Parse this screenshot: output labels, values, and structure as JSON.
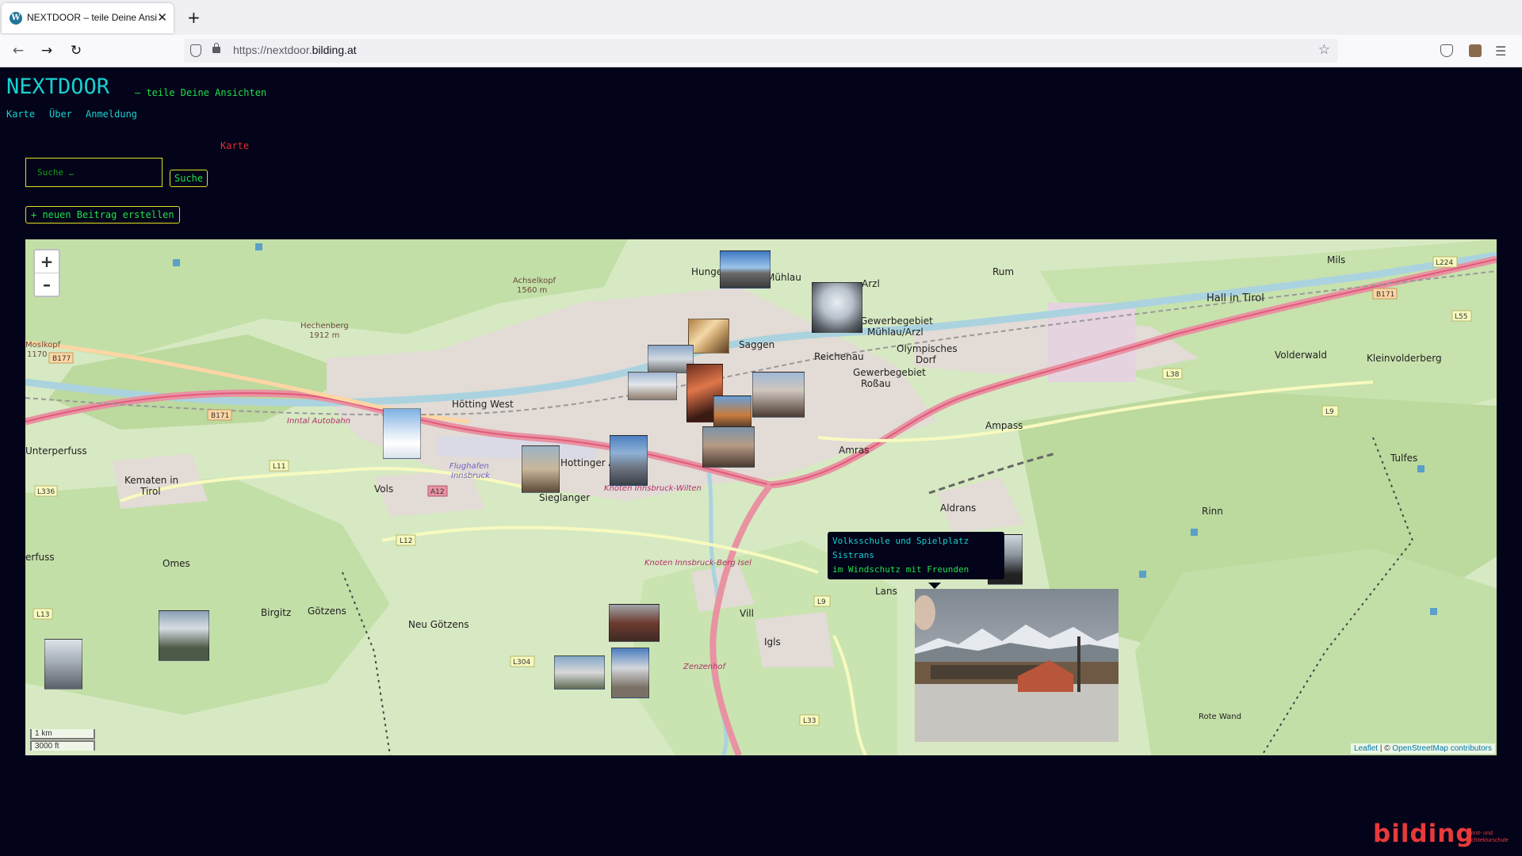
{
  "browser": {
    "tab_title": "NEXTDOOR – teile Deine Ansichten",
    "url_prefix": "https://nextdoor.",
    "url_domain": "bilding.at"
  },
  "site": {
    "title": "NEXTDOOR",
    "tagline": "– teile Deine Ansichten",
    "nav": [
      "Karte",
      "Über",
      "Anmeldung"
    ],
    "page_heading": "Karte",
    "search_placeholder": "Suche …",
    "search_button": "Suche",
    "new_post_button": "+ neuen Beitrag erstellen"
  },
  "map": {
    "zoom_in": "+",
    "zoom_out": "–",
    "scale_metric": "1 km",
    "scale_imperial": "3000 ft",
    "attribution_leaflet": "Leaflet",
    "attribution_sep": " | © ",
    "attribution_osm": "OpenStreetMap contributors",
    "labels": {
      "hungerburg": "Hunge",
      "muhlau": "Mühlau",
      "arzl": "Arzl",
      "rum": "Rum",
      "mils": "Mils",
      "hall": "Hall in Tirol",
      "saggen": "Saggen",
      "gewerbe_muhlau": "Gewerbegebiet\nMühlau/Arzl",
      "olympisches": "Olympisches\nDorf",
      "reichenau": "Reichenau",
      "gewerbe_rossau": "Gewerbegebiet\nRoßau",
      "volderwald": "Volderwald",
      "kleinvolderberg": "Kleinvolderberg",
      "hotting_west": "Hötting West",
      "innsbruck": "Innsbruck",
      "unterperfuss": "Unterperfuss",
      "kematen": "Kematen in\nTirol",
      "vols": "Vols",
      "hottinger": "Hottinger A",
      "sieglanger": "Sieglanger",
      "amras": "Amras",
      "ampass": "Ampass",
      "aldrans": "Aldrans",
      "rinn": "Rinn",
      "tulfes": "Tulfes",
      "omes": "Omes",
      "birgitz": "Birgitz",
      "gotzens": "Götzens",
      "neu_gotzens": "Neu Götzens",
      "vill": "Vill",
      "igls": "Igls",
      "lans": "Lans",
      "rote_wand": "Rote Wand",
      "perfuss": "erfuss",
      "achselkopf": "Achselkopf\n1560 m",
      "hechenberg": "Hechenberg\n1912 m",
      "moslkopf": "Moslkopf\n1170 m",
      "flughafen": "Flughafen\nInnsbruck",
      "inntal": "Inntal Autobahn",
      "b171": "B171",
      "b177": "B177",
      "l11": "L11",
      "l12": "L12",
      "l13": "L13",
      "l336": "L336",
      "a12": "A12",
      "l304": "L304",
      "l33": "L33",
      "l38": "L38",
      "l9": "L9",
      "l224": "L224",
      "l55": "L55",
      "zenzenhof": "Zenzenhof",
      "knoten_berg_isel": "Knoten Innsbruck-Berg Isel",
      "knoten_wilten": "Knoten Innsbruck-Wilten"
    }
  },
  "popup": {
    "title_line1": "Volksschule und Spielplatz",
    "title_line2": "Sistrans",
    "subtitle": "im Windschutz mit Freunden"
  },
  "footer": {
    "logo": "bilding",
    "logo_sub": "Kunst- und\nArchitekturschule"
  },
  "colors": {
    "background": "#030319",
    "title_cyan": "#18d0d0",
    "accent_green": "#1fe04a",
    "border_yellow": "#e0e020",
    "heading_red": "#e02c2c",
    "logo_red": "#e83a3a"
  }
}
